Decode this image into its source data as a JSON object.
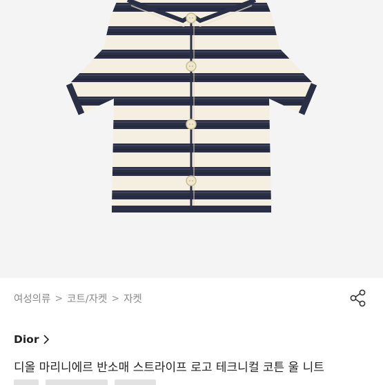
{
  "breadcrumb": {
    "items": [
      "여성의류",
      "코트/자켓",
      "자켓"
    ],
    "separator": ">"
  },
  "share": {
    "icon": "share-icon"
  },
  "brand": {
    "name": "Dior",
    "icon": "chevron-right-icon"
  },
  "product": {
    "title": "디올 마리니에르 반소매 스트라이프 로고 테크니컬 코튼 울 니트",
    "image": {
      "icon": "striped-short-sleeve-knit-jacket",
      "colors": {
        "cream": "#f5efe1",
        "navy": "#2b2f45",
        "button": "#efe6cc",
        "background": "#f4f4f4"
      }
    }
  }
}
